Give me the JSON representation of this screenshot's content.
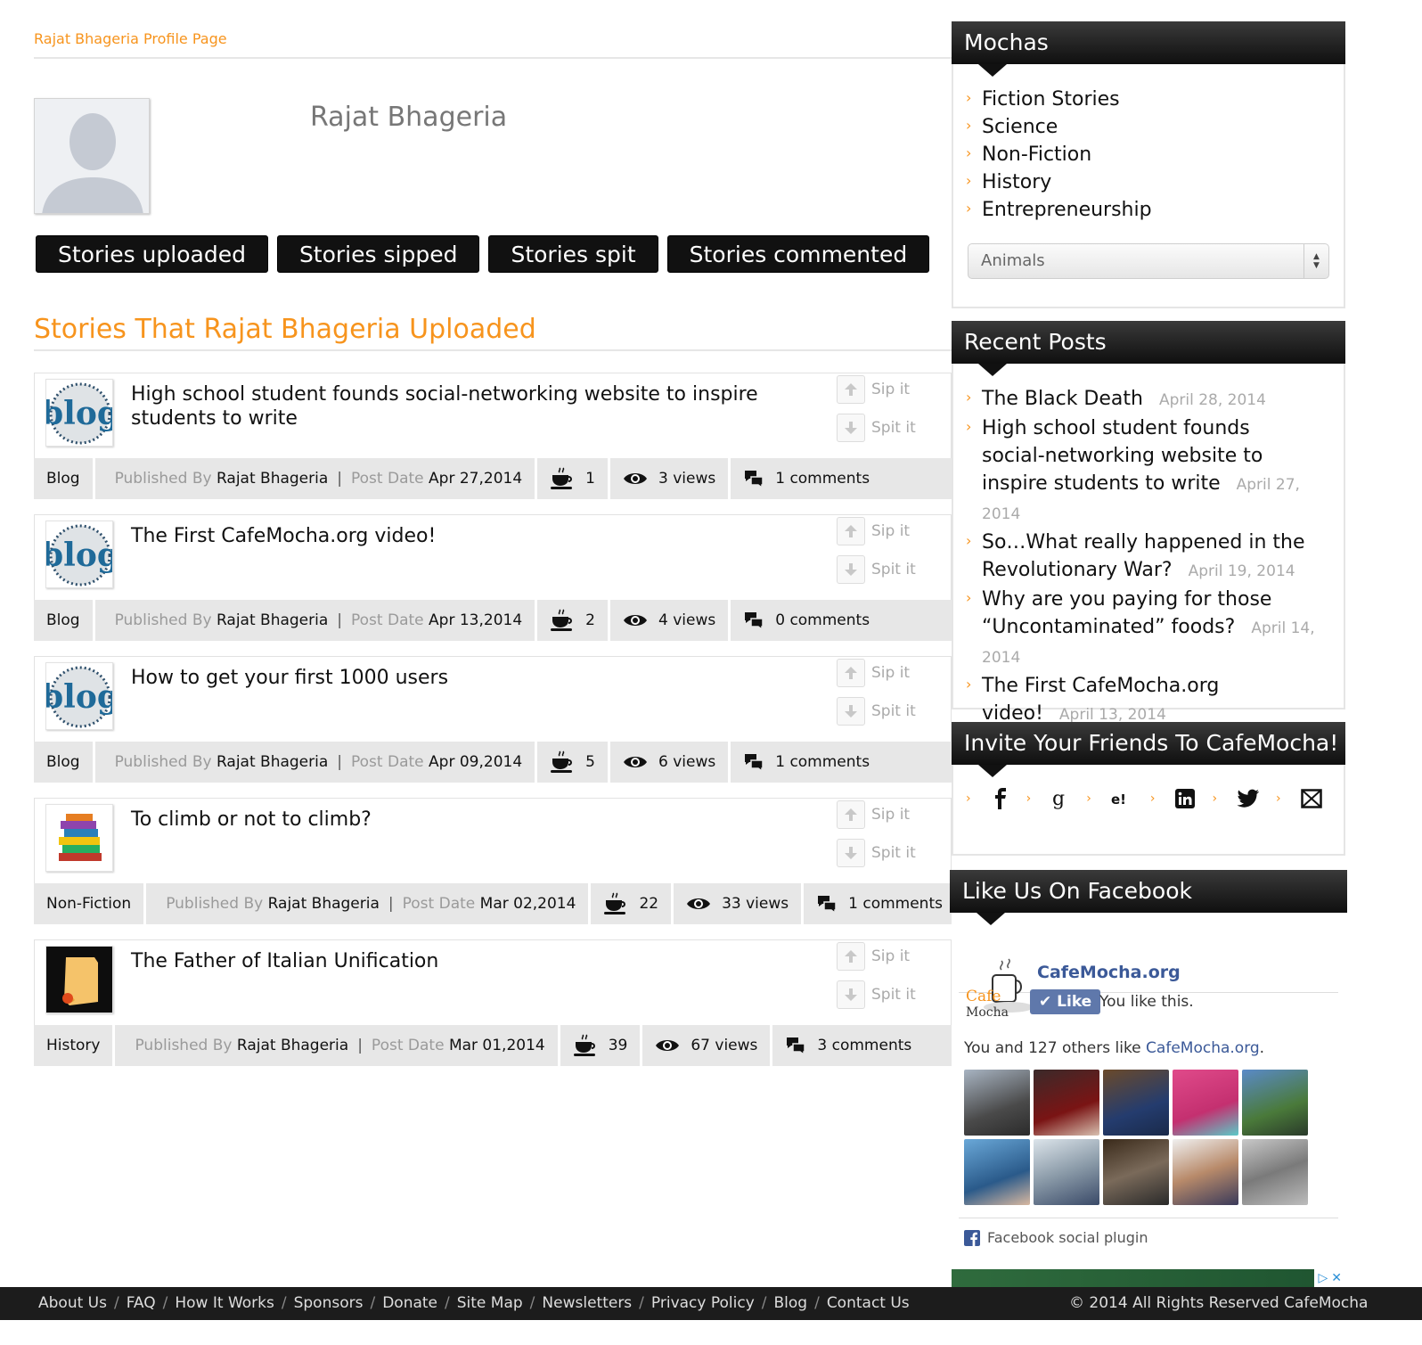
{
  "breadcrumb": "Rajat Bhageria Profile Page",
  "profile": {
    "name": "Rajat Bhageria"
  },
  "tabs": [
    "Stories uploaded",
    "Stories sipped",
    "Stories spit",
    "Stories commented"
  ],
  "section_title": "Stories That Rajat Bhageria Uploaded",
  "labels": {
    "sip": "Sip it",
    "spit": "Spit it",
    "published_by": "Published By",
    "post_date": "Post Date"
  },
  "stories": [
    {
      "title": "High school student founds social-networking website to inspire students to write",
      "category": "Blog",
      "author": "Rajat Bhageria",
      "date": "Apr 27,2014",
      "sips": "1",
      "views": "3 views",
      "comments": "1 comments",
      "thumb": "blog-icon"
    },
    {
      "title": "The First CafeMocha.org video!",
      "category": "Blog",
      "author": "Rajat Bhageria",
      "date": "Apr 13,2014",
      "sips": "2",
      "views": "4 views",
      "comments": "0 comments",
      "thumb": "blog-icon"
    },
    {
      "title": "How to get your first 1000 users",
      "category": "Blog",
      "author": "Rajat Bhageria",
      "date": "Apr 09,2014",
      "sips": "5",
      "views": "6 views",
      "comments": "1 comments",
      "thumb": "blog-icon"
    },
    {
      "title": "To climb or not to climb?",
      "category": "Non-Fiction",
      "author": "Rajat Bhageria",
      "date": "Mar 02,2014",
      "sips": "22",
      "views": "33 views",
      "comments": "1 comments",
      "thumb": "books-icon"
    },
    {
      "title": "The Father of Italian Unification",
      "category": "History",
      "author": "Rajat Bhageria",
      "date": "Mar 01,2014",
      "sips": "39",
      "views": "67 views",
      "comments": "3 comments",
      "thumb": "scroll-icon"
    }
  ],
  "sidebar": {
    "mochas": {
      "title": "Mochas",
      "items": [
        "Fiction Stories",
        "Science",
        "Non-Fiction",
        "History",
        "Entrepreneurship"
      ],
      "select_value": "Animals"
    },
    "recent": {
      "title": "Recent Posts",
      "items": [
        {
          "title": "The Black Death",
          "date": "April 28, 2014"
        },
        {
          "title": "High school student founds social-networking website to inspire students to write",
          "date": "April 27, 2014"
        },
        {
          "title": "So…What really happened in the Revolutionary War?",
          "date": "April 19, 2014"
        },
        {
          "title": "Why are you paying for those “Uncontaminated” foods?",
          "date": "April 14, 2014"
        },
        {
          "title": "The First CafeMocha.org video!",
          "date": "April 13, 2014"
        }
      ]
    },
    "invite": {
      "title": "Invite Your Friends To CafeMocha!",
      "networks": [
        "facebook-icon",
        "google-plus-icon",
        "yahoo-icon",
        "linkedin-icon",
        "twitter-icon",
        "email-icon"
      ]
    },
    "facebook": {
      "title": "Like Us On Facebook",
      "page_name": "CafeMocha.org",
      "like_label": "Like",
      "you_like": "You like this.",
      "count_prefix": "You and 127 others like ",
      "count_link": "CafeMocha.org",
      "count_suffix": ".",
      "plugin": "Facebook social plugin",
      "logo_text_1": "Cafe",
      "logo_text_2": "Mocha"
    }
  },
  "footer": {
    "links": [
      "About Us",
      "FAQ",
      "How It Works",
      "Sponsors",
      "Donate",
      "Site Map",
      "Newsletters",
      "Privacy Policy",
      "Blog",
      "Contact Us"
    ],
    "copyright": "© 2014 All Rights Reserved CafeMocha"
  },
  "colors": {
    "accent": "#f7941d",
    "header": "#111111",
    "meta_bg": "#e7e7e7",
    "facebook": "#3b5998"
  }
}
